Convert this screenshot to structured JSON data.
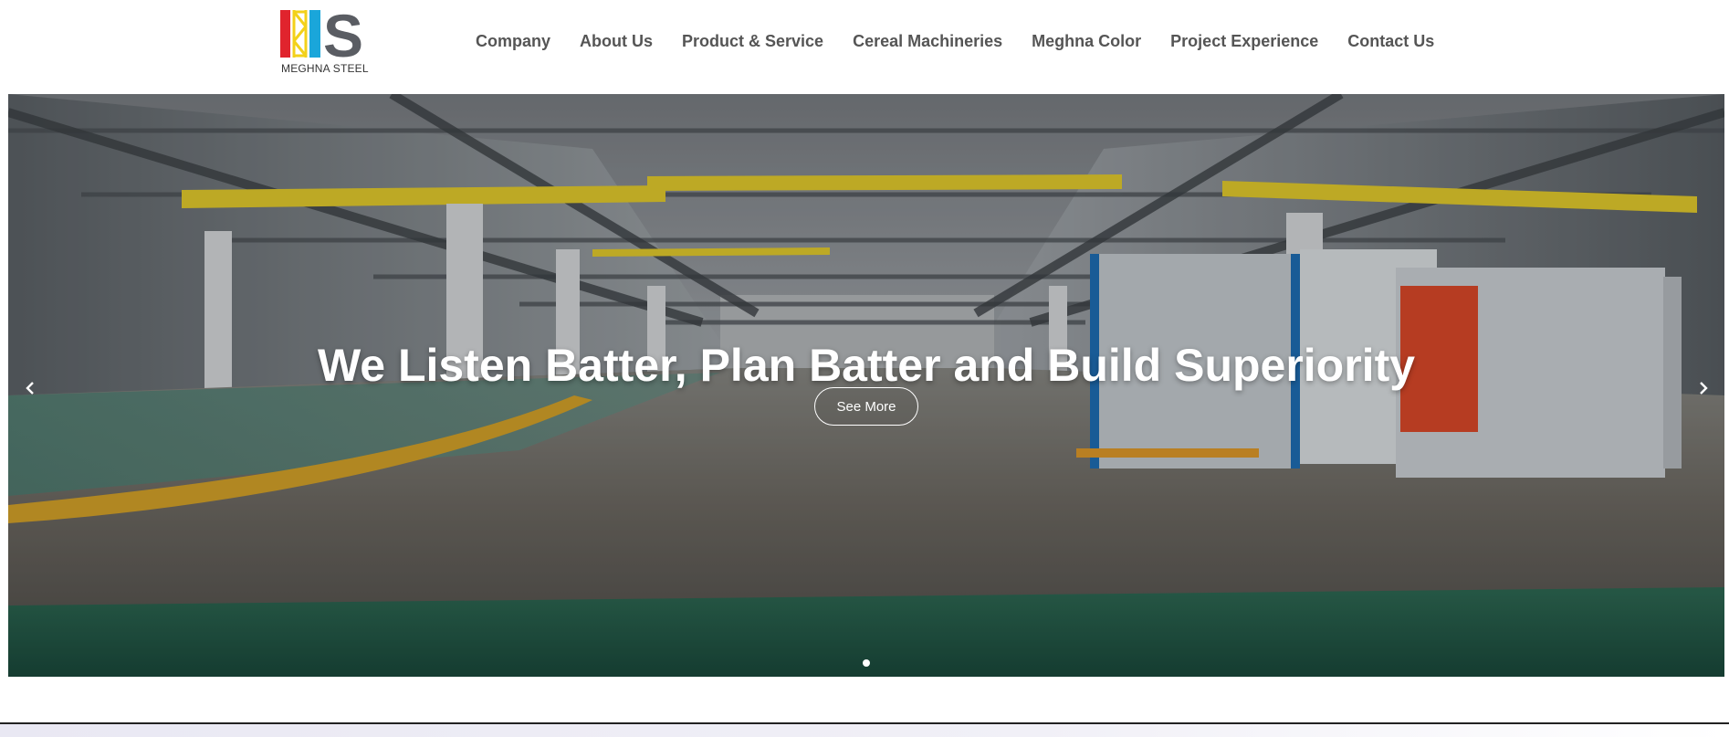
{
  "brand": {
    "logo_text": "MEGHNA STEEL",
    "colors": {
      "red": "#e0242d",
      "yellow": "#f3d11a",
      "blue": "#1aa6da",
      "gray": "#5a5d63"
    }
  },
  "nav": {
    "items": [
      {
        "label": "Company"
      },
      {
        "label": "About Us"
      },
      {
        "label": "Product & Service"
      },
      {
        "label": "Cereal Machineries"
      },
      {
        "label": "Meghna Color"
      },
      {
        "label": "Project Experience"
      },
      {
        "label": "Contact Us"
      }
    ]
  },
  "hero": {
    "title": "We Listen Batter, Plan Batter and Build Superiority",
    "button_label": "See More",
    "prev_icon": "chevron-left-icon",
    "next_icon": "chevron-right-icon",
    "slide_count": 1,
    "active_slide": 1
  }
}
